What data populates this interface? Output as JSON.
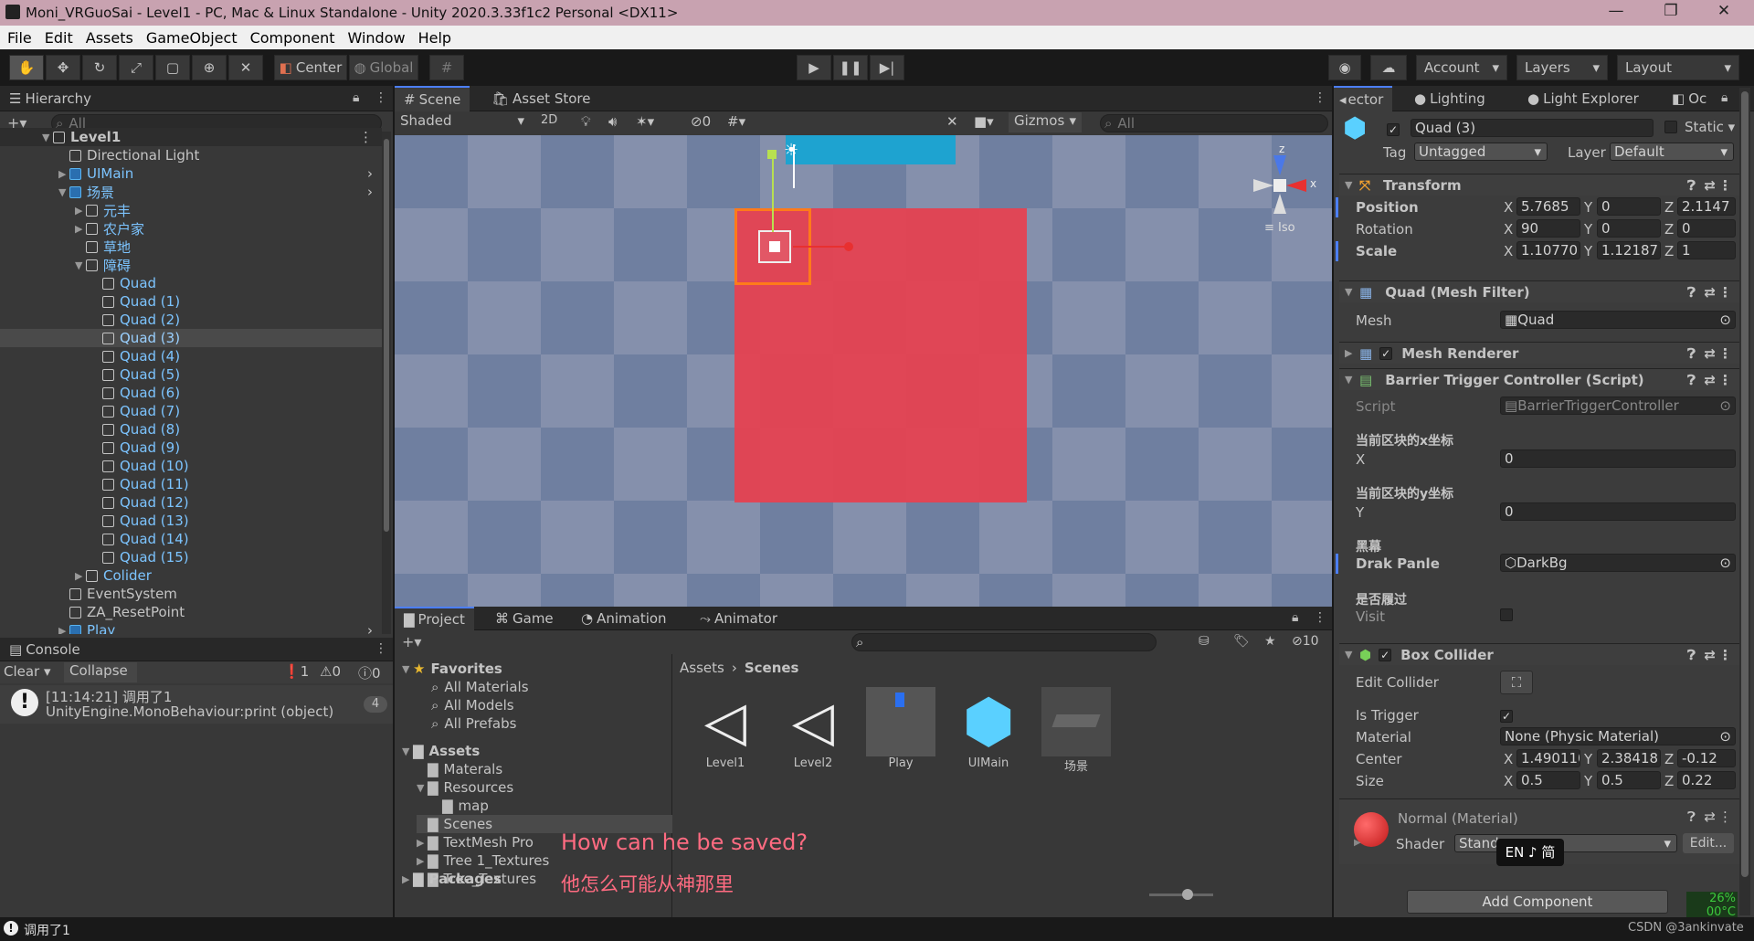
{
  "window": {
    "title": "Moni_VRGuoSai - Level1 - PC, Mac & Linux Standalone - Unity 2020.3.33f1c2 Personal <DX11>",
    "min": "—",
    "max": "❐",
    "close": "✕"
  },
  "menu": [
    "File",
    "Edit",
    "Assets",
    "GameObject",
    "Component",
    "Window",
    "Help"
  ],
  "toolbar": {
    "pivot": "Center",
    "space": "Global",
    "account": "Account",
    "layers": "Layers",
    "layout": "Layout"
  },
  "hierarchy": {
    "tab": "Hierarchy",
    "search_placeholder": "All",
    "items": [
      {
        "label": "Level1",
        "depth": 0,
        "kind": "scene",
        "arrow": "▼",
        "bold": true
      },
      {
        "label": "Directional Light",
        "depth": 1,
        "kind": "go",
        "arrow": ""
      },
      {
        "label": "UIMain",
        "depth": 1,
        "kind": "prefab",
        "arrow": "▶"
      },
      {
        "label": "场景",
        "depth": 1,
        "kind": "prefab",
        "arrow": "▼"
      },
      {
        "label": "元丰",
        "depth": 2,
        "kind": "prefab-child",
        "arrow": "▶"
      },
      {
        "label": "农户家",
        "depth": 2,
        "kind": "prefab-child",
        "arrow": "▶"
      },
      {
        "label": "草地",
        "depth": 2,
        "kind": "prefab-child",
        "arrow": ""
      },
      {
        "label": "障碍",
        "depth": 2,
        "kind": "prefab-child",
        "arrow": "▼"
      },
      {
        "label": "Quad",
        "depth": 3,
        "kind": "prefab-child",
        "arrow": ""
      },
      {
        "label": "Quad (1)",
        "depth": 3,
        "kind": "prefab-child",
        "arrow": ""
      },
      {
        "label": "Quad (2)",
        "depth": 3,
        "kind": "prefab-child",
        "arrow": ""
      },
      {
        "label": "Quad (3)",
        "depth": 3,
        "kind": "selected",
        "arrow": ""
      },
      {
        "label": "Quad (4)",
        "depth": 3,
        "kind": "prefab-child",
        "arrow": ""
      },
      {
        "label": "Quad (5)",
        "depth": 3,
        "kind": "prefab-child",
        "arrow": ""
      },
      {
        "label": "Quad (6)",
        "depth": 3,
        "kind": "prefab-child",
        "arrow": ""
      },
      {
        "label": "Quad (7)",
        "depth": 3,
        "kind": "prefab-child",
        "arrow": ""
      },
      {
        "label": "Quad (8)",
        "depth": 3,
        "kind": "prefab-child",
        "arrow": ""
      },
      {
        "label": "Quad (9)",
        "depth": 3,
        "kind": "prefab-child",
        "arrow": ""
      },
      {
        "label": "Quad (10)",
        "depth": 3,
        "kind": "prefab-child",
        "arrow": ""
      },
      {
        "label": "Quad (11)",
        "depth": 3,
        "kind": "prefab-child",
        "arrow": ""
      },
      {
        "label": "Quad (12)",
        "depth": 3,
        "kind": "prefab-child",
        "arrow": ""
      },
      {
        "label": "Quad (13)",
        "depth": 3,
        "kind": "prefab-child",
        "arrow": ""
      },
      {
        "label": "Quad (14)",
        "depth": 3,
        "kind": "prefab-child",
        "arrow": ""
      },
      {
        "label": "Quad (15)",
        "depth": 3,
        "kind": "prefab-child",
        "arrow": ""
      },
      {
        "label": "Colider",
        "depth": 2,
        "kind": "prefab-child",
        "arrow": "▶"
      },
      {
        "label": "EventSystem",
        "depth": 1,
        "kind": "go",
        "arrow": ""
      },
      {
        "label": "ZA_ResetPoint",
        "depth": 1,
        "kind": "go",
        "arrow": ""
      },
      {
        "label": "Play",
        "depth": 1,
        "kind": "prefab",
        "arrow": "▶"
      }
    ]
  },
  "console": {
    "tab": "Console",
    "clear": "Clear",
    "collapse": "Collapse",
    "errors": "1",
    "warnings": "0",
    "infos": "0",
    "log_line1": "[11:14:21] 调用了1",
    "log_line2": "UnityEngine.MonoBehaviour:print (object)",
    "log_count": "4",
    "status": "调用了1"
  },
  "scene": {
    "tab": "Scene",
    "tab2": "Asset Store",
    "shading": "Shaded",
    "mode2d": "2D",
    "hidden_count": "0",
    "gizmos": "Gizmos",
    "search_placeholder": "All",
    "iso": "Iso",
    "axis_x": "x",
    "axis_z": "z"
  },
  "project": {
    "tabs": [
      "Project",
      "Game",
      "Animation",
      "Animator"
    ],
    "hidden_count": "10",
    "breadcrumb_root": "Assets",
    "breadcrumb_current": "Scenes",
    "favorites": "Favorites",
    "fav_items": [
      "All Materials",
      "All Models",
      "All Prefabs"
    ],
    "assets_root": "Assets",
    "folders": [
      {
        "label": "Materals",
        "depth": 1,
        "arrow": ""
      },
      {
        "label": "Resources",
        "depth": 1,
        "arrow": "▼"
      },
      {
        "label": "map",
        "depth": 2,
        "arrow": ""
      },
      {
        "label": "Scenes",
        "depth": 1,
        "arrow": ""
      },
      {
        "label": "TextMesh Pro",
        "depth": 1,
        "arrow": "▶"
      },
      {
        "label": "Tree 1_Textures",
        "depth": 1,
        "arrow": "▶"
      },
      {
        "label": "Tree_Textures",
        "depth": 1,
        "arrow": ""
      }
    ],
    "packages": "Packages",
    "files": [
      "Level1",
      "Level2",
      "Play",
      "UIMain",
      "场景"
    ]
  },
  "subtitle": {
    "en": "How can he be saved?",
    "zh": "他怎么可能从神那里"
  },
  "inspector": {
    "tabs": [
      "ector",
      "Lighting",
      "Light Explorer",
      "Oc"
    ],
    "object_name": "Quad (3)",
    "static": "Static",
    "tag_label": "Tag",
    "tag": "Untagged",
    "layer_label": "Layer",
    "layer": "Default",
    "transform": {
      "title": "Transform",
      "rows": [
        {
          "label": "Position",
          "x": "5.7685",
          "y": "0",
          "z": "2.1147"
        },
        {
          "label": "Rotation",
          "x": "90",
          "y": "0",
          "z": "0"
        },
        {
          "label": "Scale",
          "x": "1.10770",
          "y": "1.12187",
          "z": "1"
        }
      ]
    },
    "mesh_filter": {
      "title": "Quad (Mesh Filter)",
      "mesh_label": "Mesh",
      "mesh": "Quad"
    },
    "mesh_renderer": {
      "title": "Mesh Renderer"
    },
    "script": {
      "title": "Barrier Trigger Controller (Script)",
      "script_label": "Script",
      "script": "BarrierTriggerController",
      "h1": "当前区块的x坐标",
      "x_label": "X",
      "x": "0",
      "h2": "当前区块的y坐标",
      "y_label": "Y",
      "y": "0",
      "h3": "黑幕",
      "drak_label": "Drak Panle",
      "drak": "DarkBg",
      "h4": "是否履过",
      "visit_label": "Visit"
    },
    "box_collider": {
      "title": "Box Collider",
      "edit_label": "Edit Collider",
      "trigger_label": "Is Trigger",
      "material_label": "Material",
      "material": "None (Physic Material)",
      "center_label": "Center",
      "cx": "1.490110",
      "cy": "2.38418",
      "cz": "-0.12",
      "size_label": "Size",
      "sx": "0.5",
      "sy": "0.5",
      "sz": "0.22"
    },
    "material": {
      "title": "Normal (Material)",
      "shader_label": "Shader",
      "shader": "Stand",
      "edit": "Edit..."
    },
    "ime": "EN ♪ 简",
    "add_component": "Add Component",
    "perf_top": "26%",
    "perf_bottom": "00°C",
    "watermark": "CSDN @3ankinvate"
  },
  "colors": {
    "accent": "#4c7fff",
    "prefab": "#5ab4f0",
    "red": "#e8404e",
    "sky": "#1ea3d0",
    "subtitle": "#ff6b81"
  }
}
